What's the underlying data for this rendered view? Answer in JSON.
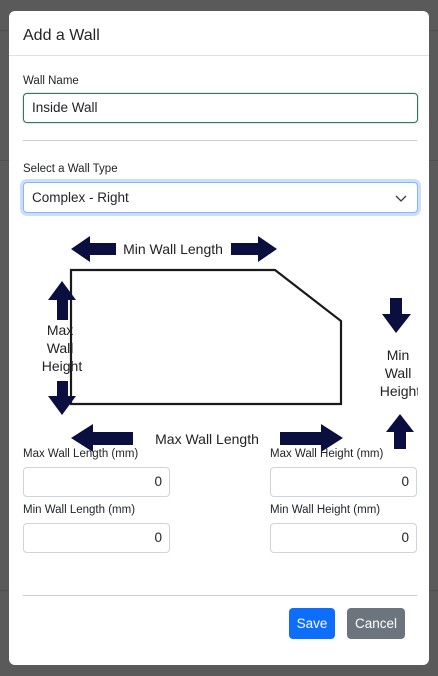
{
  "modal": {
    "title": "Add a Wall"
  },
  "wall_name": {
    "label": "Wall Name",
    "value": "Inside Wall"
  },
  "wall_type": {
    "label": "Select a Wall Type",
    "selected": "Complex - Right"
  },
  "diagram": {
    "min_wall_length": "Min Wall Length",
    "max_wall_length": "Max Wall Length",
    "max_wall_height_lines": [
      "Max",
      "Wall",
      "Height"
    ],
    "min_wall_height_lines": [
      "Min",
      "Wall",
      "Height"
    ],
    "arrow_color": "#0b0f3f"
  },
  "fields": {
    "max_wall_length": {
      "label": "Max Wall Length (mm)",
      "value": "0"
    },
    "max_wall_height": {
      "label": "Max Wall Height (mm)",
      "value": "0"
    },
    "min_wall_length": {
      "label": "Min Wall Length (mm)",
      "value": "0"
    },
    "min_wall_height": {
      "label": "Min Wall Height (mm)",
      "value": "0"
    }
  },
  "footer": {
    "save_label": "Save",
    "cancel_label": "Cancel"
  },
  "colors": {
    "primary": "#0d6efd",
    "secondary": "#6c757d",
    "focus_border": "#86b7fe",
    "valid_border": "#2c7a57"
  }
}
